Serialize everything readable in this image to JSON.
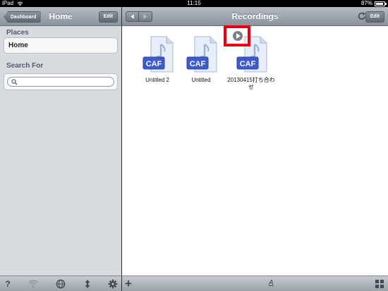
{
  "status_bar": {
    "carrier": "iPad",
    "time": "11:15",
    "battery_percent": "87%",
    "battery_level": 0.87
  },
  "master": {
    "back_button": "Dashboard",
    "title": "Home",
    "edit_button": "Edit",
    "places_header": "Places",
    "places_items": [
      "Home"
    ],
    "search_header": "Search For",
    "search_value": "",
    "toolbar_icons": [
      "help-icon",
      "wifi-icon",
      "globe-icon",
      "transfer-icon",
      "gear-icon"
    ]
  },
  "detail": {
    "title": "Recordings",
    "edit_button": "Edit",
    "files": [
      {
        "name": "Untitled 2",
        "type": "CAF"
      },
      {
        "name": "Untitled",
        "type": "CAF"
      },
      {
        "name": "20130415打ち合わせ",
        "type": "CAF"
      }
    ],
    "toolbar_icons": [
      "add-icon",
      "sort-icon",
      "grid-view-icon"
    ],
    "sort_label": "A"
  },
  "colors": {
    "accent_blue": "#3d5bc9",
    "highlight_red": "#e60012"
  }
}
